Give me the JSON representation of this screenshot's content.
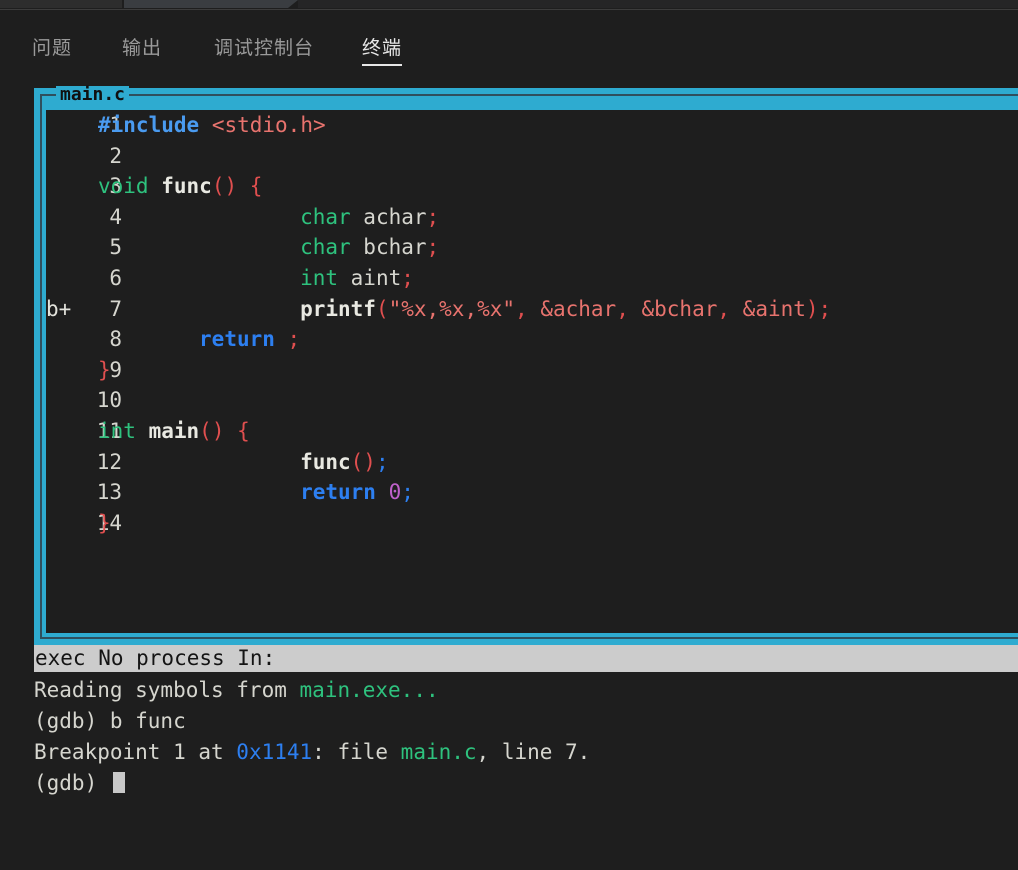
{
  "window": {
    "editor_tabs": [
      "",
      ""
    ],
    "background": "#1e1e1e"
  },
  "panel": {
    "tabs": [
      {
        "label": "问题",
        "active": false
      },
      {
        "label": "输出",
        "active": false
      },
      {
        "label": "调试控制台",
        "active": false
      },
      {
        "label": "终端",
        "active": true
      }
    ]
  },
  "terminal": {
    "tui": {
      "title": "main.c",
      "border_color": "#2eabd0",
      "lines": [
        {
          "mark": "",
          "no": "1",
          "src_indent": 0,
          "tokens": [
            {
              "t": "#include",
              "c": "k-pre"
            },
            {
              "t": " ",
              "c": "k-plain"
            },
            {
              "t": "<stdio.h>",
              "c": "k-hdr"
            }
          ]
        },
        {
          "mark": "",
          "no": "2",
          "src_indent": 0,
          "tokens": []
        },
        {
          "mark": "",
          "no": "3",
          "src_indent": 0,
          "tokens": [
            {
              "t": "void",
              "c": "k-type"
            },
            {
              "t": " ",
              "c": "k-plain"
            },
            {
              "t": "func",
              "c": "k-fn"
            },
            {
              "t": "()",
              "c": "k-punc"
            },
            {
              "t": " ",
              "c": "k-plain"
            },
            {
              "t": "{",
              "c": "k-punc"
            }
          ]
        },
        {
          "mark": "",
          "no": "4",
          "src_indent": 4,
          "tokens": [
            {
              "t": "char",
              "c": "k-type"
            },
            {
              "t": " achar",
              "c": "k-id"
            },
            {
              "t": ";",
              "c": "k-semi"
            }
          ]
        },
        {
          "mark": "",
          "no": "5",
          "src_indent": 4,
          "tokens": [
            {
              "t": "char",
              "c": "k-type"
            },
            {
              "t": " bchar",
              "c": "k-id"
            },
            {
              "t": ";",
              "c": "k-semi"
            }
          ]
        },
        {
          "mark": "",
          "no": "6",
          "src_indent": 4,
          "tokens": [
            {
              "t": "int",
              "c": "k-type"
            },
            {
              "t": " aint",
              "c": "k-id"
            },
            {
              "t": ";",
              "c": "k-semi"
            }
          ]
        },
        {
          "mark": "b+",
          "no": "7",
          "src_indent": 4,
          "tokens": [
            {
              "t": "printf",
              "c": "k-fn"
            },
            {
              "t": "(",
              "c": "k-punc"
            },
            {
              "t": "\"%x,%x,%x\"",
              "c": "k-str"
            },
            {
              "t": ",",
              "c": "k-punc"
            },
            {
              "t": " &achar",
              "c": "k-arg"
            },
            {
              "t": ",",
              "c": "k-punc"
            },
            {
              "t": " &bchar",
              "c": "k-arg"
            },
            {
              "t": ",",
              "c": "k-punc"
            },
            {
              "t": " &aint",
              "c": "k-arg"
            },
            {
              "t": ")",
              "c": "k-punc"
            },
            {
              "t": ";",
              "c": "k-semi"
            }
          ]
        },
        {
          "mark": "",
          "no": "8",
          "src_indent": 2,
          "tokens": [
            {
              "t": "return",
              "c": "k-ret"
            },
            {
              "t": " ",
              "c": "k-plain"
            },
            {
              "t": ";",
              "c": "k-semi"
            }
          ]
        },
        {
          "mark": "",
          "no": "9",
          "src_indent": 0,
          "tokens": [
            {
              "t": "}",
              "c": "k-punc"
            }
          ]
        },
        {
          "mark": "",
          "no": "10",
          "src_indent": 0,
          "tokens": []
        },
        {
          "mark": "",
          "no": "11",
          "src_indent": 0,
          "tokens": [
            {
              "t": "int",
              "c": "k-type"
            },
            {
              "t": " ",
              "c": "k-plain"
            },
            {
              "t": "main",
              "c": "k-fn"
            },
            {
              "t": "()",
              "c": "k-punc"
            },
            {
              "t": " ",
              "c": "k-plain"
            },
            {
              "t": "{",
              "c": "k-punc"
            }
          ]
        },
        {
          "mark": "",
          "no": "12",
          "src_indent": 4,
          "tokens": [
            {
              "t": "func",
              "c": "k-fn"
            },
            {
              "t": "()",
              "c": "k-punc"
            },
            {
              "t": ";",
              "c": "k-semi-b"
            }
          ]
        },
        {
          "mark": "",
          "no": "13",
          "src_indent": 4,
          "tokens": [
            {
              "t": "return",
              "c": "k-ret"
            },
            {
              "t": " ",
              "c": "k-plain"
            },
            {
              "t": "0",
              "c": "k-num"
            },
            {
              "t": ";",
              "c": "k-semi-b"
            }
          ]
        },
        {
          "mark": "",
          "no": "14",
          "src_indent": 0,
          "tokens": [
            {
              "t": "}",
              "c": "k-punc"
            }
          ]
        }
      ]
    },
    "status_bar": "exec No process In:",
    "console": [
      {
        "segments": [
          {
            "t": "Reading symbols from ",
            "c": "c-white"
          },
          {
            "t": "main.exe",
            "c": "c-green"
          },
          {
            "t": "...",
            "c": "c-green"
          }
        ]
      },
      {
        "segments": [
          {
            "t": "(gdb) b func",
            "c": "c-white"
          }
        ]
      },
      {
        "segments": [
          {
            "t": "Breakpoint 1 at ",
            "c": "c-white"
          },
          {
            "t": "0x1141",
            "c": "c-blue"
          },
          {
            "t": ": file ",
            "c": "c-white"
          },
          {
            "t": "main.c",
            "c": "c-green"
          },
          {
            "t": ", line 7.",
            "c": "c-white"
          }
        ]
      },
      {
        "segments": [
          {
            "t": "(gdb) ",
            "c": "c-white"
          }
        ],
        "cursor": true
      }
    ]
  }
}
